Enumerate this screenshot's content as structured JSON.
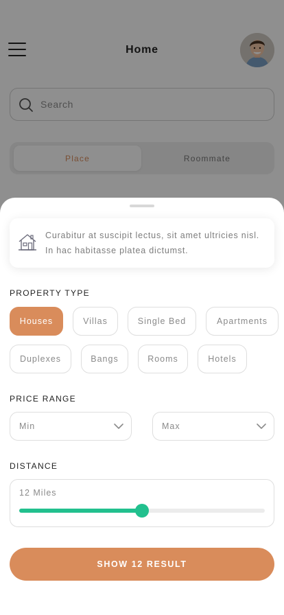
{
  "header": {
    "title": "Home",
    "menu_icon": "hamburger-menu-icon",
    "avatar_icon": "user-avatar"
  },
  "search": {
    "placeholder": "Search",
    "value": "",
    "icon": "search-icon"
  },
  "tabs": [
    {
      "label": "Place",
      "active": true
    },
    {
      "label": "Roommate",
      "active": false
    }
  ],
  "filter_sheet": {
    "info": {
      "icon": "house-icon",
      "text": "Curabitur at suscipit lectus, sit amet ultricies nisl. In hac habitasse platea dictumst."
    },
    "property_type": {
      "label": "PROPERTY TYPE",
      "options": [
        {
          "label": "Houses",
          "selected": true
        },
        {
          "label": "Villas",
          "selected": false
        },
        {
          "label": "Single Bed",
          "selected": false
        },
        {
          "label": "Apartments",
          "selected": false
        },
        {
          "label": "Duplexes",
          "selected": false
        },
        {
          "label": "Bangs",
          "selected": false
        },
        {
          "label": "Rooms",
          "selected": false
        },
        {
          "label": "Hotels",
          "selected": false
        }
      ]
    },
    "price_range": {
      "label": "PRICE RANGE",
      "min_placeholder": "Min",
      "max_placeholder": "Max"
    },
    "distance": {
      "label": "DISTANCE",
      "value_text": "12 Miles",
      "slider_fraction": 0.5
    },
    "submit_label": "SHOW 12 RESULT"
  },
  "colors": {
    "accent": "#d98c5b",
    "slider": "#22c08e",
    "text_dark": "#1f1f1f",
    "text_muted": "#8a8a8a"
  }
}
